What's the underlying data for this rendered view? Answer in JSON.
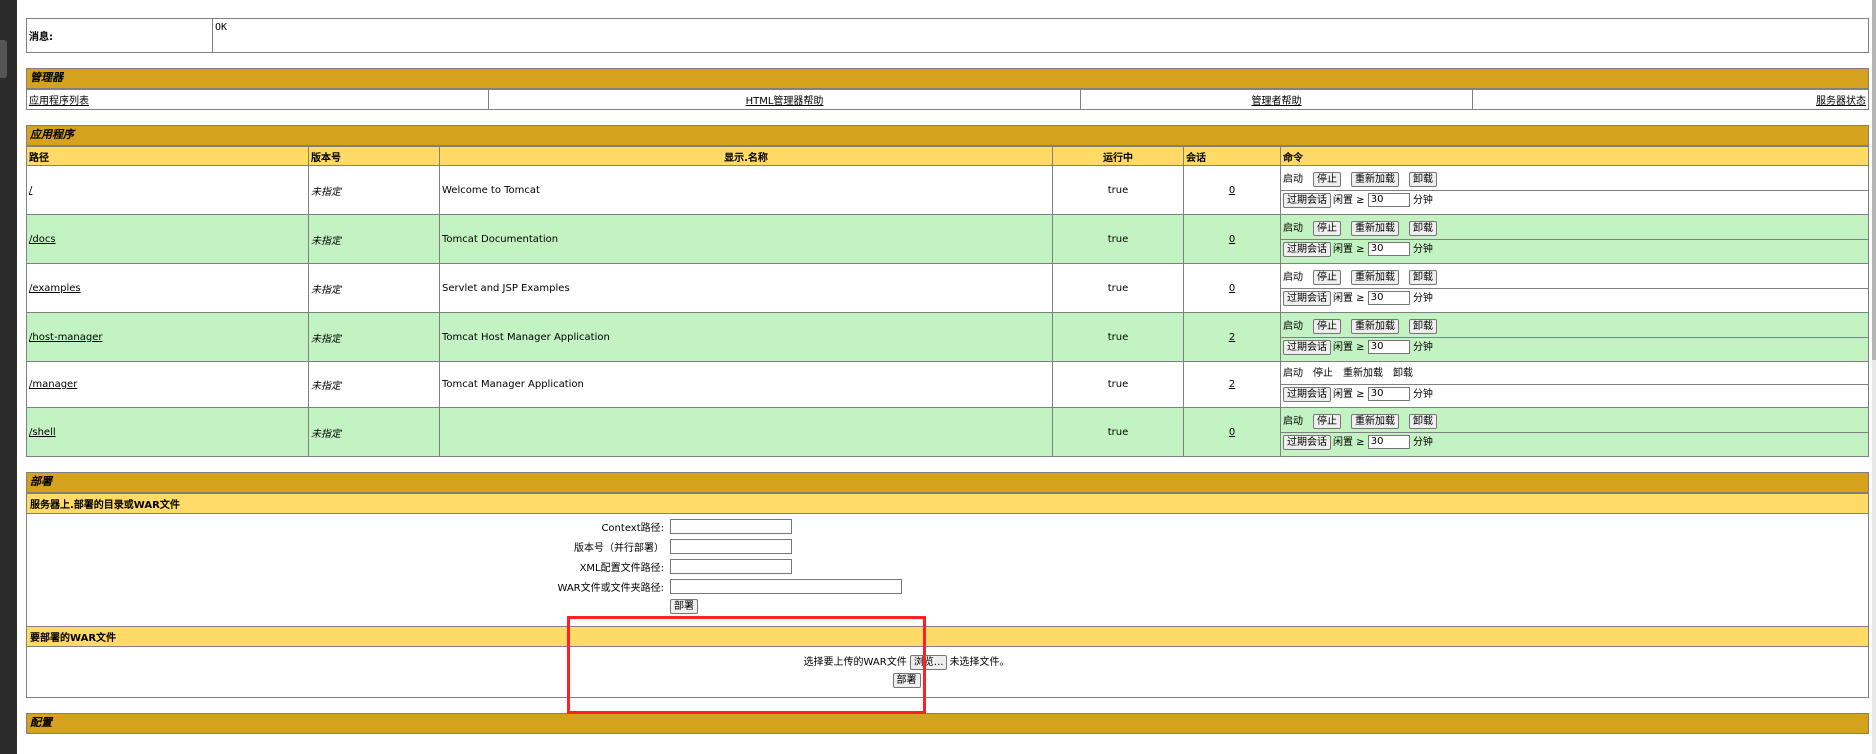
{
  "message": {
    "label": "消息:",
    "value": "OK"
  },
  "manager": {
    "title": "管理器",
    "links": [
      "应用程序列表",
      "HTML管理器帮助",
      "管理者帮助",
      "服务器状态"
    ]
  },
  "applications": {
    "title": "应用程序",
    "headers": [
      "路径",
      "版本号",
      "显示.名称",
      "运行中",
      "会话",
      "命令"
    ],
    "rows": [
      {
        "path": "/",
        "version": "未指定",
        "name": "Welcome to Tomcat",
        "running": "true",
        "sessions": "0"
      },
      {
        "path": "/docs",
        "version": "未指定",
        "name": "Tomcat Documentation",
        "running": "true",
        "sessions": "0"
      },
      {
        "path": "/examples",
        "version": "未指定",
        "name": "Servlet and JSP Examples",
        "running": "true",
        "sessions": "0"
      },
      {
        "path": "/host-manager",
        "version": "未指定",
        "name": "Tomcat Host Manager Application",
        "running": "true",
        "sessions": "2"
      },
      {
        "path": "/manager",
        "version": "未指定",
        "name": "Tomcat Manager Application",
        "running": "true",
        "sessions": "2"
      },
      {
        "path": "/shell",
        "version": "未指定",
        "name": "",
        "running": "true",
        "sessions": "0"
      }
    ],
    "commands": {
      "start": "启动",
      "stop": "停止",
      "reload": "重新加载",
      "undeploy": "卸载",
      "expire": "过期会话",
      "idle": "闲置 ≥",
      "idle_value": "30",
      "minutes": "分钟"
    }
  },
  "deploy": {
    "title": "部署",
    "server_dir_title": "服务器上.部署的目录或WAR文件",
    "fields": [
      "Context路径:",
      "版本号（并行部署）",
      "XML配置文件路径:",
      "WAR文件或文件夹路径:"
    ],
    "deploy_button": "部署",
    "war_title": "要部署的WAR文件",
    "war_label": "选择要上传的WAR文件",
    "browse_button": "浏览...",
    "no_file": "未选择文件。",
    "war_deploy_button": "部署"
  },
  "config": {
    "title": "配置"
  }
}
